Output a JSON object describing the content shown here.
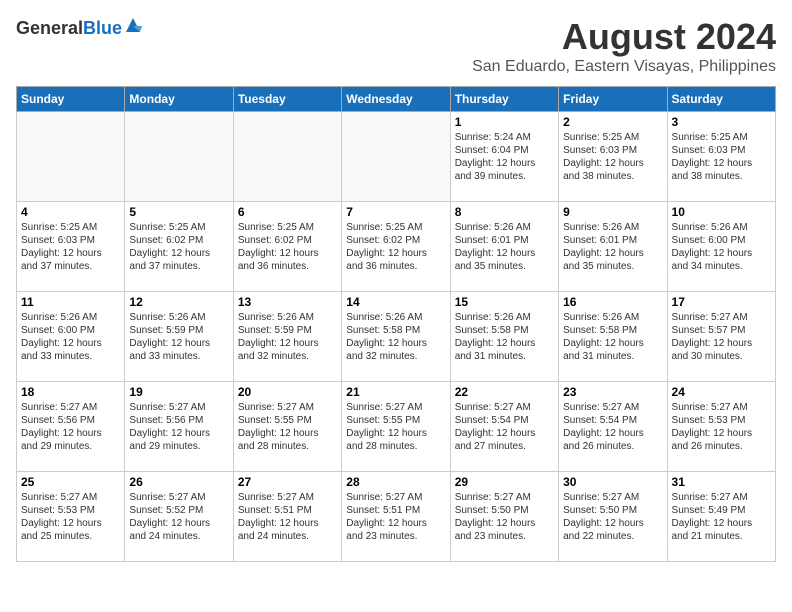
{
  "header": {
    "logo_general": "General",
    "logo_blue": "Blue",
    "month_year": "August 2024",
    "location": "San Eduardo, Eastern Visayas, Philippines"
  },
  "weekdays": [
    "Sunday",
    "Monday",
    "Tuesday",
    "Wednesday",
    "Thursday",
    "Friday",
    "Saturday"
  ],
  "weeks": [
    [
      {
        "day": "",
        "info": ""
      },
      {
        "day": "",
        "info": ""
      },
      {
        "day": "",
        "info": ""
      },
      {
        "day": "",
        "info": ""
      },
      {
        "day": "1",
        "info": "Sunrise: 5:24 AM\nSunset: 6:04 PM\nDaylight: 12 hours\nand 39 minutes."
      },
      {
        "day": "2",
        "info": "Sunrise: 5:25 AM\nSunset: 6:03 PM\nDaylight: 12 hours\nand 38 minutes."
      },
      {
        "day": "3",
        "info": "Sunrise: 5:25 AM\nSunset: 6:03 PM\nDaylight: 12 hours\nand 38 minutes."
      }
    ],
    [
      {
        "day": "4",
        "info": "Sunrise: 5:25 AM\nSunset: 6:03 PM\nDaylight: 12 hours\nand 37 minutes."
      },
      {
        "day": "5",
        "info": "Sunrise: 5:25 AM\nSunset: 6:02 PM\nDaylight: 12 hours\nand 37 minutes."
      },
      {
        "day": "6",
        "info": "Sunrise: 5:25 AM\nSunset: 6:02 PM\nDaylight: 12 hours\nand 36 minutes."
      },
      {
        "day": "7",
        "info": "Sunrise: 5:25 AM\nSunset: 6:02 PM\nDaylight: 12 hours\nand 36 minutes."
      },
      {
        "day": "8",
        "info": "Sunrise: 5:26 AM\nSunset: 6:01 PM\nDaylight: 12 hours\nand 35 minutes."
      },
      {
        "day": "9",
        "info": "Sunrise: 5:26 AM\nSunset: 6:01 PM\nDaylight: 12 hours\nand 35 minutes."
      },
      {
        "day": "10",
        "info": "Sunrise: 5:26 AM\nSunset: 6:00 PM\nDaylight: 12 hours\nand 34 minutes."
      }
    ],
    [
      {
        "day": "11",
        "info": "Sunrise: 5:26 AM\nSunset: 6:00 PM\nDaylight: 12 hours\nand 33 minutes."
      },
      {
        "day": "12",
        "info": "Sunrise: 5:26 AM\nSunset: 5:59 PM\nDaylight: 12 hours\nand 33 minutes."
      },
      {
        "day": "13",
        "info": "Sunrise: 5:26 AM\nSunset: 5:59 PM\nDaylight: 12 hours\nand 32 minutes."
      },
      {
        "day": "14",
        "info": "Sunrise: 5:26 AM\nSunset: 5:58 PM\nDaylight: 12 hours\nand 32 minutes."
      },
      {
        "day": "15",
        "info": "Sunrise: 5:26 AM\nSunset: 5:58 PM\nDaylight: 12 hours\nand 31 minutes."
      },
      {
        "day": "16",
        "info": "Sunrise: 5:26 AM\nSunset: 5:58 PM\nDaylight: 12 hours\nand 31 minutes."
      },
      {
        "day": "17",
        "info": "Sunrise: 5:27 AM\nSunset: 5:57 PM\nDaylight: 12 hours\nand 30 minutes."
      }
    ],
    [
      {
        "day": "18",
        "info": "Sunrise: 5:27 AM\nSunset: 5:56 PM\nDaylight: 12 hours\nand 29 minutes."
      },
      {
        "day": "19",
        "info": "Sunrise: 5:27 AM\nSunset: 5:56 PM\nDaylight: 12 hours\nand 29 minutes."
      },
      {
        "day": "20",
        "info": "Sunrise: 5:27 AM\nSunset: 5:55 PM\nDaylight: 12 hours\nand 28 minutes."
      },
      {
        "day": "21",
        "info": "Sunrise: 5:27 AM\nSunset: 5:55 PM\nDaylight: 12 hours\nand 28 minutes."
      },
      {
        "day": "22",
        "info": "Sunrise: 5:27 AM\nSunset: 5:54 PM\nDaylight: 12 hours\nand 27 minutes."
      },
      {
        "day": "23",
        "info": "Sunrise: 5:27 AM\nSunset: 5:54 PM\nDaylight: 12 hours\nand 26 minutes."
      },
      {
        "day": "24",
        "info": "Sunrise: 5:27 AM\nSunset: 5:53 PM\nDaylight: 12 hours\nand 26 minutes."
      }
    ],
    [
      {
        "day": "25",
        "info": "Sunrise: 5:27 AM\nSunset: 5:53 PM\nDaylight: 12 hours\nand 25 minutes."
      },
      {
        "day": "26",
        "info": "Sunrise: 5:27 AM\nSunset: 5:52 PM\nDaylight: 12 hours\nand 24 minutes."
      },
      {
        "day": "27",
        "info": "Sunrise: 5:27 AM\nSunset: 5:51 PM\nDaylight: 12 hours\nand 24 minutes."
      },
      {
        "day": "28",
        "info": "Sunrise: 5:27 AM\nSunset: 5:51 PM\nDaylight: 12 hours\nand 23 minutes."
      },
      {
        "day": "29",
        "info": "Sunrise: 5:27 AM\nSunset: 5:50 PM\nDaylight: 12 hours\nand 23 minutes."
      },
      {
        "day": "30",
        "info": "Sunrise: 5:27 AM\nSunset: 5:50 PM\nDaylight: 12 hours\nand 22 minutes."
      },
      {
        "day": "31",
        "info": "Sunrise: 5:27 AM\nSunset: 5:49 PM\nDaylight: 12 hours\nand 21 minutes."
      }
    ]
  ]
}
